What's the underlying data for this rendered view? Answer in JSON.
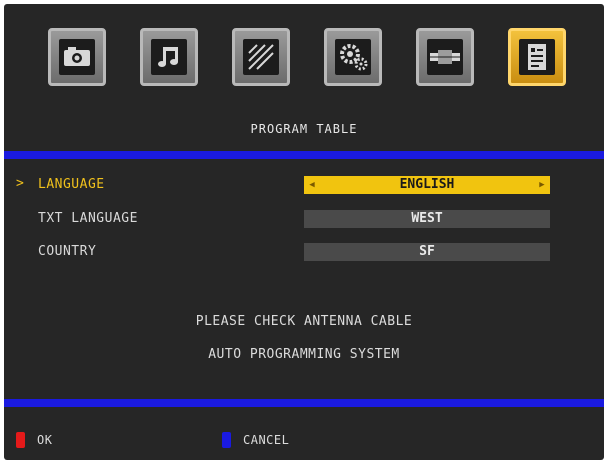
{
  "menu_icons": [
    {
      "name": "picture-icon",
      "selected": false
    },
    {
      "name": "sound-icon",
      "selected": false
    },
    {
      "name": "time-icon",
      "selected": false
    },
    {
      "name": "setup-icon",
      "selected": false
    },
    {
      "name": "connection-icon",
      "selected": false
    },
    {
      "name": "program-table-icon",
      "selected": true
    }
  ],
  "title": "PROGRAM TABLE",
  "settings": [
    {
      "label": "LANGUAGE",
      "value": "ENGLISH",
      "active": true
    },
    {
      "label": "TXT LANGUAGE",
      "value": "WEST",
      "active": false
    },
    {
      "label": "COUNTRY",
      "value": "SF",
      "active": false
    }
  ],
  "active_marker": ">",
  "nav": {
    "left": "◀",
    "right": "▶"
  },
  "messages": [
    "PLEASE CHECK ANTENNA CABLE",
    "AUTO PROGRAMMING SYSTEM"
  ],
  "footer": {
    "ok_label": "OK",
    "ok_color": "#e41a1a",
    "cancel_label": "CANCEL",
    "cancel_color": "#1a1ae0"
  },
  "colors": {
    "accent": "#f1c40f",
    "divider": "#1a1ae0",
    "background": "#262626"
  }
}
